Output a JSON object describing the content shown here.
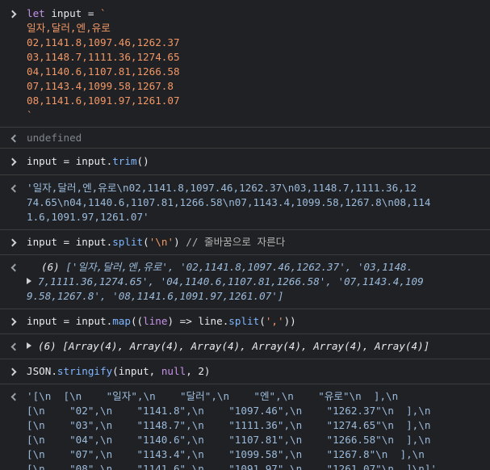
{
  "console": {
    "entry1": {
      "lines": [
        "let input = `",
        "일자,달러,엔,유로",
        "02,1141.8,1097.46,1262.37",
        "03,1148.7,1111.36,1274.65",
        "04,1140.6,1107.81,1266.58",
        "07,1143.4,1099.58,1267.8",
        "08,1141.6,1091.97,1261.07",
        "`"
      ],
      "kw": "let",
      "var": "input",
      "eq": "=",
      "tick": "`"
    },
    "result1": "undefined",
    "entry2": {
      "var": "input",
      "eq": "=",
      "obj": "input.",
      "fn": "trim",
      "tail": "()"
    },
    "result2": [
      "'일자,달러,엔,유로\\n02,1141.8,1097.46,1262.37\\n03,1148.7,1111.36,12",
      "74.65\\n04,1140.6,1107.81,1266.58\\n07,1143.4,1099.58,1267.8\\n08,114",
      "1.6,1091.97,1261.07'"
    ],
    "entry3": {
      "var": "input",
      "eq": "=",
      "obj": "input.",
      "fn": "split",
      "open": "(",
      "arg": "'\\n'",
      "close": ")",
      "comment": "// 줄바꿈으로 자른다"
    },
    "result3": {
      "count": "(6)",
      "line1": " ['일자,달러,엔,유로', '02,1141.8,1097.46,1262.37', '03,1148.",
      "line2": "7,1111.36,1274.65', '04,1140.6,1107.81,1266.58', '07,1143.4,109",
      "line3": "9.58,1267.8', '08,1141.6,1091.97,1261.07']"
    },
    "entry4": {
      "var": "input",
      "eq": "=",
      "obj": "input.",
      "fn": "map",
      "open": "((",
      "param": "line",
      "arrow": ") => line.",
      "fn2": "split",
      "arg": "','",
      "close": "))"
    },
    "result4": "(6) [Array(4), Array(4), Array(4), Array(4), Array(4), Array(4)]",
    "entry5": {
      "obj": "JSON.",
      "fn": "stringify",
      "open": "(input, ",
      "kw": "null",
      "close": ", 2)"
    },
    "result5": [
      "'[\\n  [\\n    \"일자\",\\n    \"달러\",\\n    \"엔\",\\n    \"유로\"\\n  ],\\n",
      "[\\n    \"02\",\\n    \"1141.8\",\\n    \"1097.46\",\\n    \"1262.37\"\\n  ],\\n",
      "[\\n    \"03\",\\n    \"1148.7\",\\n    \"1111.36\",\\n    \"1274.65\"\\n  ],\\n",
      "[\\n    \"04\",\\n    \"1140.6\",\\n    \"1107.81\",\\n    \"1266.58\"\\n  ],\\n",
      "[\\n    \"07\",\\n    \"1143.4\",\\n    \"1099.58\",\\n    \"1267.8\"\\n  ],\\n",
      "[\\n    \"08\",\\n    \"1141.6\",\\n    \"1091.97\",\\n    \"1261.07\"\\n  ]\\n]'"
    ]
  },
  "colors": {
    "background": "#202124",
    "string_orange": "#f29766",
    "string_blue": "#9bbbdc",
    "keyword": "#c792ea",
    "function": "#7fb6ff"
  },
  "icons": {
    "input_prompt": "chevron-right-icon",
    "output_prompt": "chevron-left-icon",
    "expand": "triangle-right-icon"
  }
}
